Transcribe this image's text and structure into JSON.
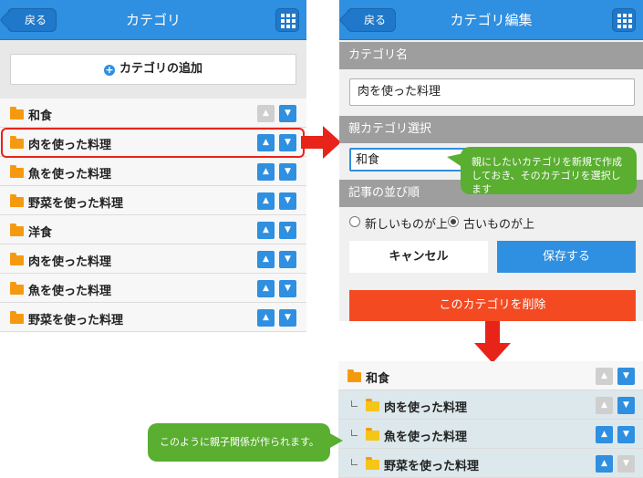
{
  "left": {
    "back_label": "戻る",
    "title": "カテゴリ",
    "add_label": "カテゴリの追加",
    "rows": [
      {
        "name": "和食",
        "up": false,
        "down": true
      },
      {
        "name": "肉を使った料理",
        "up": true,
        "down": true
      },
      {
        "name": "魚を使った料理",
        "up": true,
        "down": true
      },
      {
        "name": "野菜を使った料理",
        "up": true,
        "down": true
      },
      {
        "name": "洋食",
        "up": true,
        "down": true
      },
      {
        "name": "肉を使った料理",
        "up": true,
        "down": true
      },
      {
        "name": "魚を使った料理",
        "up": true,
        "down": true
      },
      {
        "name": "野菜を使った料理",
        "up": true,
        "down": true
      }
    ]
  },
  "right": {
    "back_label": "戻る",
    "title": "カテゴリ編集",
    "name_section": "カテゴリ名",
    "name_value": "肉を使った料理",
    "parent_section": "親カテゴリ選択",
    "parent_value": "和食",
    "order_section": "記事の並び順",
    "order_options": [
      "新しいものが上",
      "古いものが上"
    ],
    "order_selected": "古いものが上",
    "cancel_label": "キャンセル",
    "save_label": "保存する",
    "delete_label": "このカテゴリを削除"
  },
  "callouts": {
    "parent_tip": "親にしたいカテゴリを新規で作成しておき、そのカテゴリを選択します",
    "result_tip": "このように親子関係が作られます。"
  },
  "result": {
    "rows": [
      {
        "name": "和食",
        "child": false,
        "up": false,
        "down": true
      },
      {
        "name": "肉を使った料理",
        "child": true,
        "up": false,
        "down": true
      },
      {
        "name": "魚を使った料理",
        "child": true,
        "up": true,
        "down": true
      },
      {
        "name": "野菜を使った料理",
        "child": true,
        "up": true,
        "down": false
      }
    ]
  },
  "colors": {
    "accent": "#2f8fe0",
    "delete": "#f44a22",
    "arrow": "#e8241a",
    "tip": "#5aae30"
  },
  "icons": {
    "back": "back-arrow-icon",
    "menu": "grid-menu-icon",
    "folder": "folder-icon",
    "add": "plus-circle-icon"
  }
}
